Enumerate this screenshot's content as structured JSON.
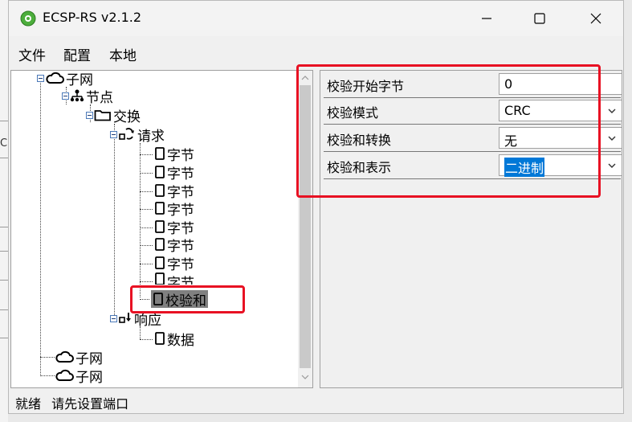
{
  "window": {
    "title": "ECSP-RS v2.1.2"
  },
  "menu": [
    "文件",
    "配置",
    "本地"
  ],
  "background_fragment": "CF",
  "tree": {
    "subnet_label": "子网",
    "node_label": "节点",
    "exchange_label": "交换",
    "request_label": "请求",
    "byte_items": [
      "字节",
      "字节",
      "字节",
      "字节",
      "字节",
      "字节",
      "字节",
      "字节"
    ],
    "checksum_label": "校验和",
    "response_label": "响应",
    "data_label": "数据",
    "other_subnets": [
      "子网",
      "子网"
    ]
  },
  "properties": [
    {
      "label": "校验开始字节",
      "value": "0",
      "dropdown": false,
      "selected": false
    },
    {
      "label": "校验模式",
      "value": "CRC",
      "dropdown": true,
      "selected": false
    },
    {
      "label": "校验和转换",
      "value": "无",
      "dropdown": true,
      "selected": false
    },
    {
      "label": "校验和表示",
      "value": "二进制",
      "dropdown": true,
      "selected": true
    }
  ],
  "status": {
    "left": "就绪",
    "message": "请先设置端口"
  },
  "colors": {
    "highlight": "#e81123",
    "selection": "#0078d7",
    "tree_selection": "#808080"
  }
}
